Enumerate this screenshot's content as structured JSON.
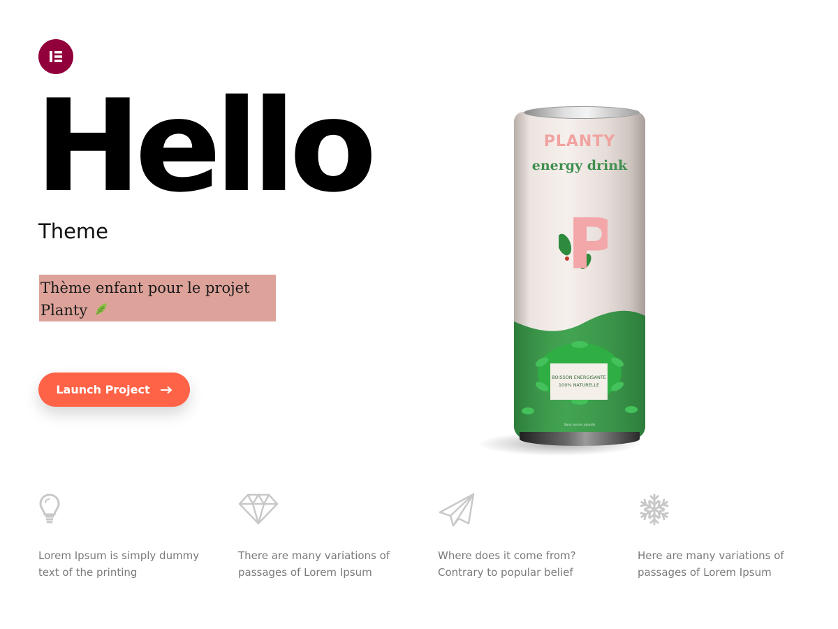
{
  "brand": {
    "logo_letters": "E"
  },
  "hero": {
    "title": "Hello",
    "subtitle": "Theme",
    "description": "Thème enfant pour le projet Planty",
    "cta_label": "Launch Project",
    "cta_icon": "arrow-right-icon"
  },
  "product": {
    "brand_name": "PLANTY",
    "tagline": "energy drink",
    "letter": "P",
    "label_line1": "BOISSON ENERGISANTE",
    "label_line2": "100% NATURELLE",
    "fine_print": "Sans sucres ajoutés"
  },
  "features": [
    {
      "icon": "lightbulb-icon",
      "text": "Lorem Ipsum is simply dummy text of the printing"
    },
    {
      "icon": "diamond-icon",
      "text": "There are many variations of passages of Lorem Ipsum"
    },
    {
      "icon": "paper-plane-icon",
      "text": "Where does it come from? Contrary to popular belief"
    },
    {
      "icon": "snowflake-icon",
      "text": "Here are many variations of passages of Lorem Ipsum"
    }
  ],
  "colors": {
    "logo_bg": "#92003b",
    "cta_bg": "#ff6347",
    "highlight_bg": "#dda39a",
    "can_green": "#3a9a4a",
    "brand_pink": "#f0a3a0",
    "icon_gray": "#c8c8c8",
    "text_gray": "#7a7a7a"
  }
}
